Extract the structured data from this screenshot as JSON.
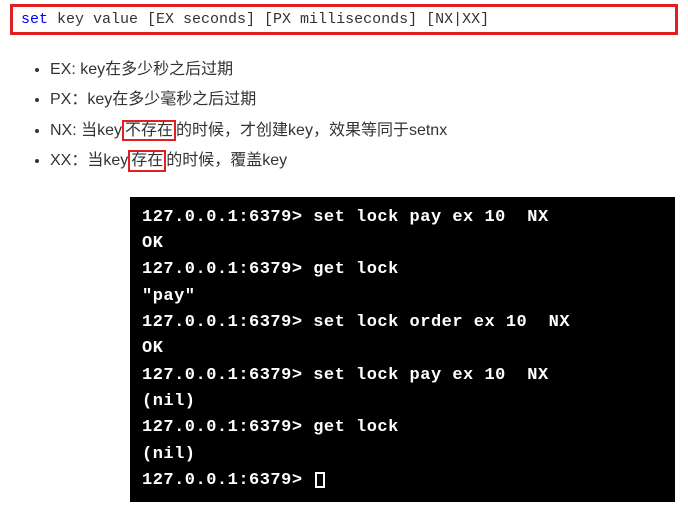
{
  "syntax": {
    "keyword": "set",
    "rest": " key value [EX seconds] [PX milliseconds] [NX|XX]"
  },
  "bullets": {
    "ex": {
      "prefix": "EX: key在多少秒之后过期"
    },
    "px": {
      "prefix": "PX：key在多少毫秒之后过期"
    },
    "nx": {
      "p1": "NX: 当key",
      "hl": "不存在",
      "p2": "的时候，才创建key，效果等同于setnx"
    },
    "xx": {
      "p1": "XX：当key",
      "hl": "存在",
      "p2": "的时候，覆盖key"
    }
  },
  "terminal": {
    "l1": "127.0.0.1:6379> set lock pay ex 10  NX",
    "l2": "OK",
    "l3": "127.0.0.1:6379> get lock",
    "l4": "\"pay\"",
    "l5": "127.0.0.1:6379> set lock order ex 10  NX",
    "l6": "OK",
    "l7": "127.0.0.1:6379> set lock pay ex 10  NX",
    "l8": "(nil)",
    "l9": "127.0.0.1:6379> get lock",
    "l10": "(nil)",
    "l11": "127.0.0.1:6379> "
  }
}
